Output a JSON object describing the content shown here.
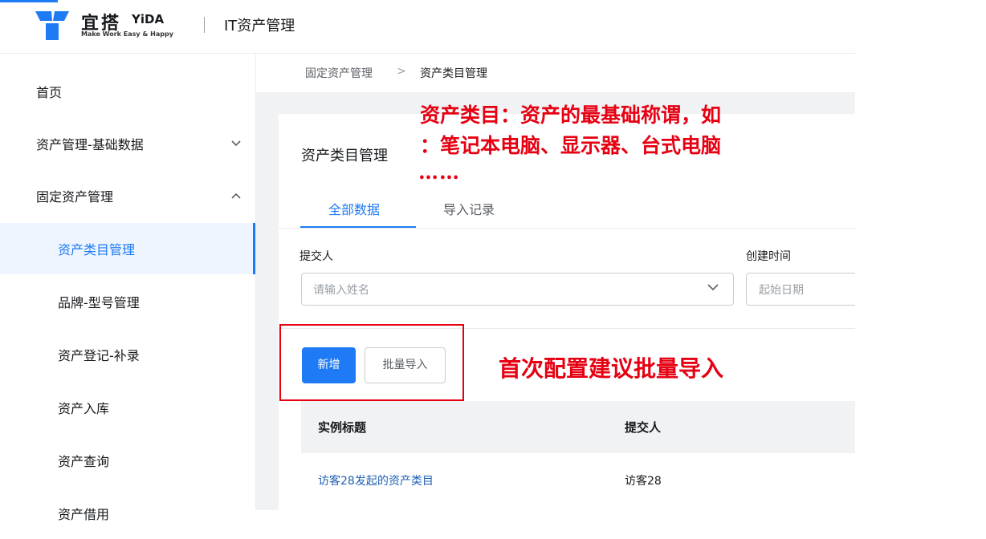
{
  "header": {
    "logo_cn": "宜搭",
    "logo_en": "YiDA",
    "logo_slogan": "Make Work Easy & Happy",
    "app_title": "IT资产管理"
  },
  "sidebar": {
    "items": [
      {
        "label": "首页"
      },
      {
        "label": "资产管理-基础数据",
        "expanded": false
      },
      {
        "label": "固定资产管理",
        "expanded": true
      },
      {
        "label": "资产类目管理",
        "active": true
      },
      {
        "label": "品牌-型号管理"
      },
      {
        "label": "资产登记-补录"
      },
      {
        "label": "资产入库"
      },
      {
        "label": "资产查询"
      },
      {
        "label": "资产借用"
      }
    ]
  },
  "breadcrumb": {
    "items": [
      "固定资产管理",
      "资产类目管理"
    ],
    "separator": ">"
  },
  "page": {
    "title": "资产类目管理"
  },
  "tabs": [
    {
      "label": "全部数据",
      "active": true
    },
    {
      "label": "导入记录",
      "active": false
    }
  ],
  "filters": {
    "submitter_label": "提交人",
    "submitter_placeholder": "请输入姓名",
    "created_label": "创建时间",
    "created_placeholder": "起始日期"
  },
  "actions": {
    "new_label": "新增",
    "bulk_import_label": "批量导入"
  },
  "table": {
    "columns": [
      "实例标题",
      "提交人"
    ],
    "rows": [
      [
        "访客28发起的资产类目",
        "访客28"
      ]
    ]
  },
  "annotations": {
    "note_1_line1": "资产类目：资产的最基础称谓，如",
    "note_1_line2": "：笔记本电脑、显示器、台式电脑",
    "note_1_line3": "……",
    "note_2": "首次配置建议批量导入"
  },
  "colors": {
    "primary": "#1f7bf5",
    "annotation_red": "#e60012",
    "active_nav_bg": "#eef5ff",
    "content_bg": "#f1f2f3"
  }
}
